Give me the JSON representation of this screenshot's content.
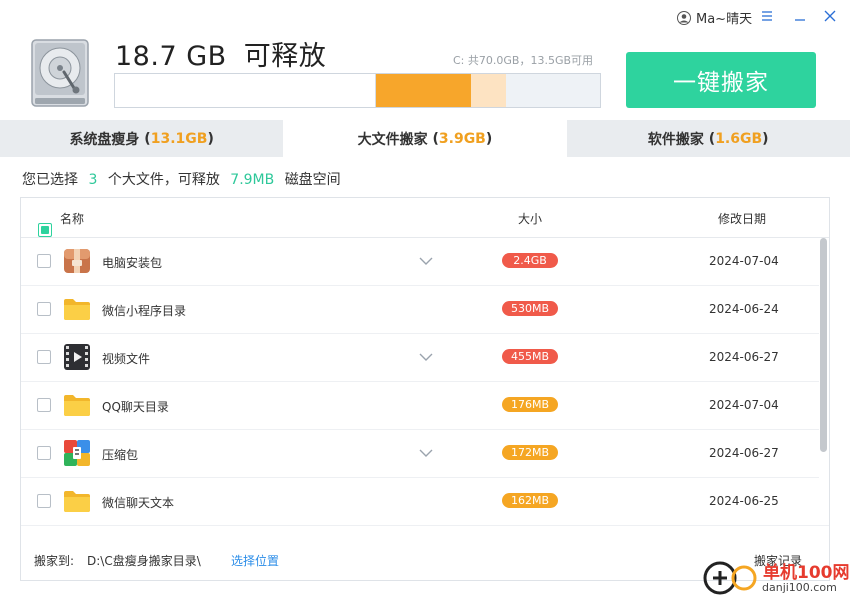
{
  "window": {
    "user_name": "Ma~晴天",
    "menu_icon": "hamburger-icon",
    "minimize_icon": "minimize-icon",
    "close_icon": "close-icon"
  },
  "header": {
    "free_amount": "18.7 GB",
    "free_label": "可释放",
    "disk_info": "C: 共70.0GB，13.5GB可用",
    "move_button": "一键搬家"
  },
  "tabs": [
    {
      "label": "系统盘瘦身",
      "size": "13.1GB",
      "active": false
    },
    {
      "label": "大文件搬家",
      "size": "3.9GB",
      "active": true
    },
    {
      "label": "软件搬家",
      "size": "1.6GB",
      "active": false
    }
  ],
  "summary": {
    "prefix": "您已选择",
    "count": "3",
    "mid": "个大文件，可释放",
    "amount": "7.9MB",
    "suffix": "磁盘空间"
  },
  "table": {
    "headers": {
      "name": "名称",
      "size": "大小",
      "date": "修改日期"
    },
    "rows": [
      {
        "name": "电脑安装包",
        "size": "2.4GB",
        "date": "2024-07-04",
        "icon": "package-icon",
        "expandable": true,
        "badge_color": "#f05a4a"
      },
      {
        "name": "微信小程序目录",
        "size": "530MB",
        "date": "2024-06-24",
        "icon": "folder-icon",
        "expandable": false,
        "badge_color": "#f05a4a"
      },
      {
        "name": "视频文件",
        "size": "455MB",
        "date": "2024-06-27",
        "icon": "video-icon",
        "expandable": true,
        "badge_color": "#f05a4a"
      },
      {
        "name": "QQ聊天目录",
        "size": "176MB",
        "date": "2024-07-04",
        "icon": "folder-icon",
        "expandable": false,
        "badge_color": "#f5a623"
      },
      {
        "name": "压缩包",
        "size": "172MB",
        "date": "2024-06-27",
        "icon": "archive-icon",
        "expandable": true,
        "badge_color": "#f5a623"
      },
      {
        "name": "微信聊天文本",
        "size": "162MB",
        "date": "2024-06-25",
        "icon": "folder-icon",
        "expandable": false,
        "badge_color": "#f5a623"
      }
    ]
  },
  "footer": {
    "move_to_label": "搬家到:",
    "path": "D:\\C盘瘦身搬家目录\\",
    "choose_location": "选择位置",
    "history": "搬家记录"
  },
  "watermark": {
    "text": "单机100网",
    "sub": "danji100.com"
  },
  "colors": {
    "accent": "#2ed39e",
    "orange": "#f7a62b",
    "red_badge": "#f05a4a",
    "link": "#2b8de8"
  }
}
